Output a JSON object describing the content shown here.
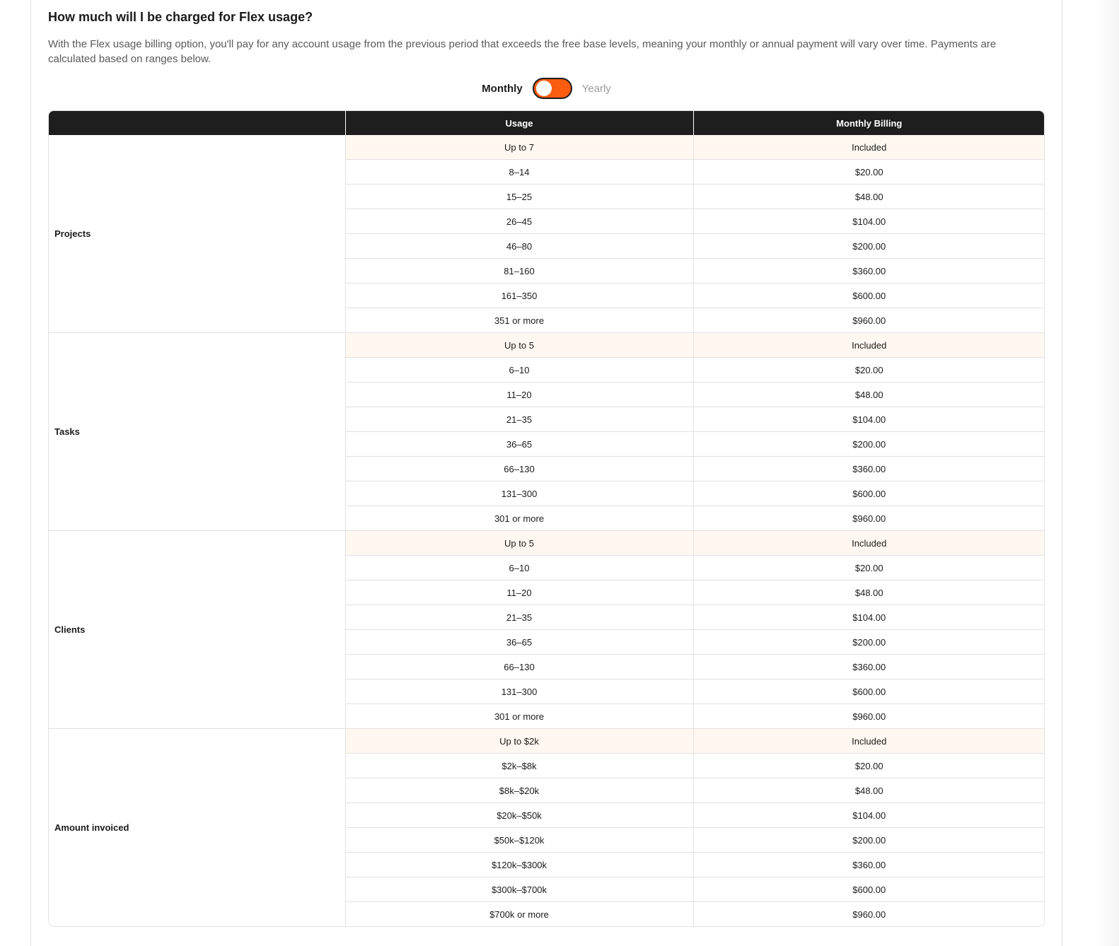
{
  "faq": {
    "title": "How much will I be charged for Flex usage?",
    "body": "With the Flex usage billing option, you'll pay for any account usage from the previous period that exceeds the free base levels, meaning your monthly or annual payment will vary over time. Payments are calculated based on ranges below."
  },
  "billing_toggle": {
    "left_label": "Monthly",
    "right_label": "Yearly",
    "selected": "Monthly",
    "accent_color": "#fb5c10"
  },
  "table": {
    "headers": [
      "",
      "Usage",
      "Monthly Billing"
    ],
    "groups": [
      {
        "category": "Projects",
        "rows": [
          {
            "usage": "Up to 7",
            "billing": "Included"
          },
          {
            "usage": "8–14",
            "billing": "$20.00"
          },
          {
            "usage": "15–25",
            "billing": "$48.00"
          },
          {
            "usage": "26–45",
            "billing": "$104.00"
          },
          {
            "usage": "46–80",
            "billing": "$200.00"
          },
          {
            "usage": "81–160",
            "billing": "$360.00"
          },
          {
            "usage": "161–350",
            "billing": "$600.00"
          },
          {
            "usage": "351 or more",
            "billing": "$960.00"
          }
        ]
      },
      {
        "category": "Tasks",
        "rows": [
          {
            "usage": "Up to 5",
            "billing": "Included"
          },
          {
            "usage": "6–10",
            "billing": "$20.00"
          },
          {
            "usage": "11–20",
            "billing": "$48.00"
          },
          {
            "usage": "21–35",
            "billing": "$104.00"
          },
          {
            "usage": "36–65",
            "billing": "$200.00"
          },
          {
            "usage": "66–130",
            "billing": "$360.00"
          },
          {
            "usage": "131–300",
            "billing": "$600.00"
          },
          {
            "usage": "301 or more",
            "billing": "$960.00"
          }
        ]
      },
      {
        "category": "Clients",
        "rows": [
          {
            "usage": "Up to 5",
            "billing": "Included"
          },
          {
            "usage": "6–10",
            "billing": "$20.00"
          },
          {
            "usage": "11–20",
            "billing": "$48.00"
          },
          {
            "usage": "21–35",
            "billing": "$104.00"
          },
          {
            "usage": "36–65",
            "billing": "$200.00"
          },
          {
            "usage": "66–130",
            "billing": "$360.00"
          },
          {
            "usage": "131–300",
            "billing": "$600.00"
          },
          {
            "usage": "301 or more",
            "billing": "$960.00"
          }
        ]
      },
      {
        "category": "Amount invoiced",
        "rows": [
          {
            "usage": "Up to $2k",
            "billing": "Included"
          },
          {
            "usage": "$2k–$8k",
            "billing": "$20.00"
          },
          {
            "usage": "$8k–$20k",
            "billing": "$48.00"
          },
          {
            "usage": "$20k–$50k",
            "billing": "$104.00"
          },
          {
            "usage": "$50k–$120k",
            "billing": "$200.00"
          },
          {
            "usage": "$120k–$300k",
            "billing": "$360.00"
          },
          {
            "usage": "$300k–$700k",
            "billing": "$600.00"
          },
          {
            "usage": "$700k or more",
            "billing": "$960.00"
          }
        ]
      }
    ]
  }
}
